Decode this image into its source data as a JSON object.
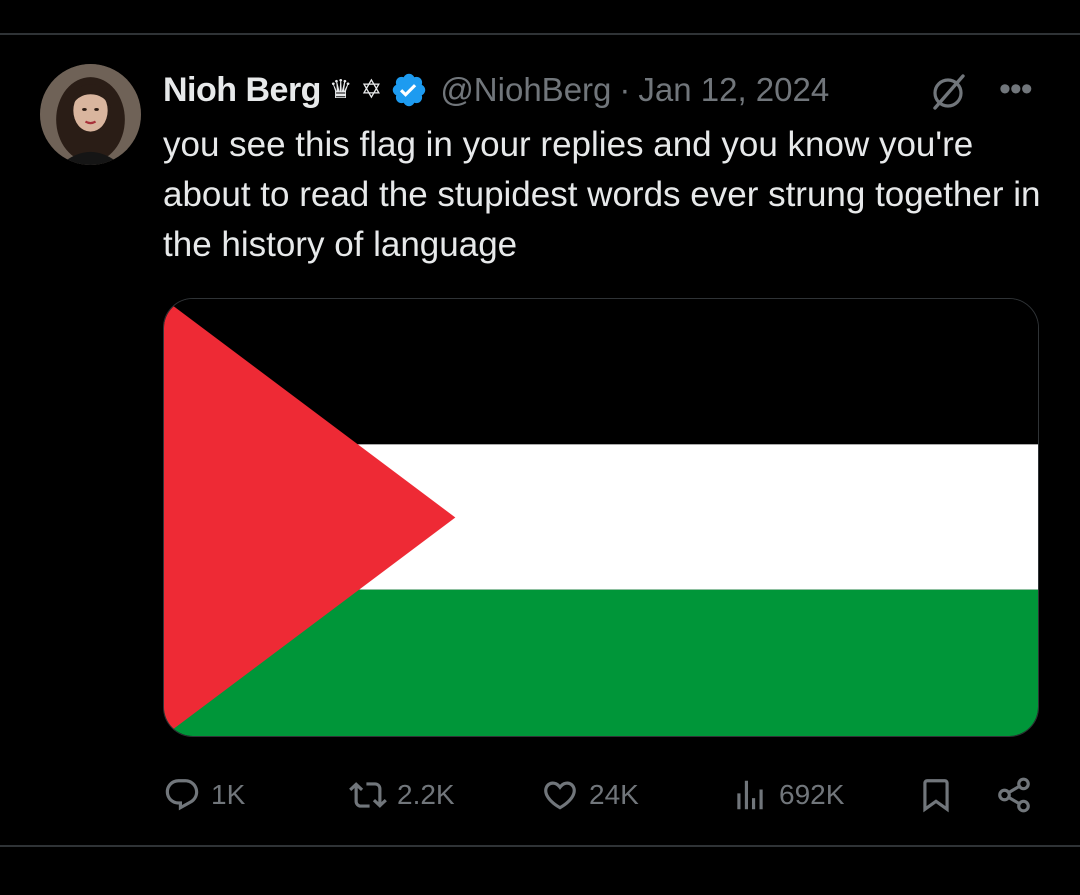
{
  "tweet": {
    "author_name": "Nioh Berg",
    "badge_emojis": "♛ ✡",
    "handle": "@NiohBerg",
    "separator": "·",
    "date": "Jan 12, 2024",
    "text": "you see this flag in your replies and you know you're about to read the stupidest words ever strung together in the history of language"
  },
  "media": {
    "flag_colors": {
      "black": "#000000",
      "white": "#ffffff",
      "green": "#009639",
      "red": "#ee2a35"
    }
  },
  "actions": {
    "replies": "1K",
    "reposts": "2.2K",
    "likes": "24K",
    "views": "692K"
  },
  "icons": [
    "grok-icon",
    "more-icon",
    "verified-icon",
    "reply-icon",
    "repost-icon",
    "like-icon",
    "views-icon",
    "bookmark-icon",
    "share-icon"
  ],
  "colors": {
    "background": "#000000",
    "text": "#e7e9ea",
    "muted": "#71767b",
    "verified": "#1d9bf0",
    "border": "#2f3336"
  }
}
